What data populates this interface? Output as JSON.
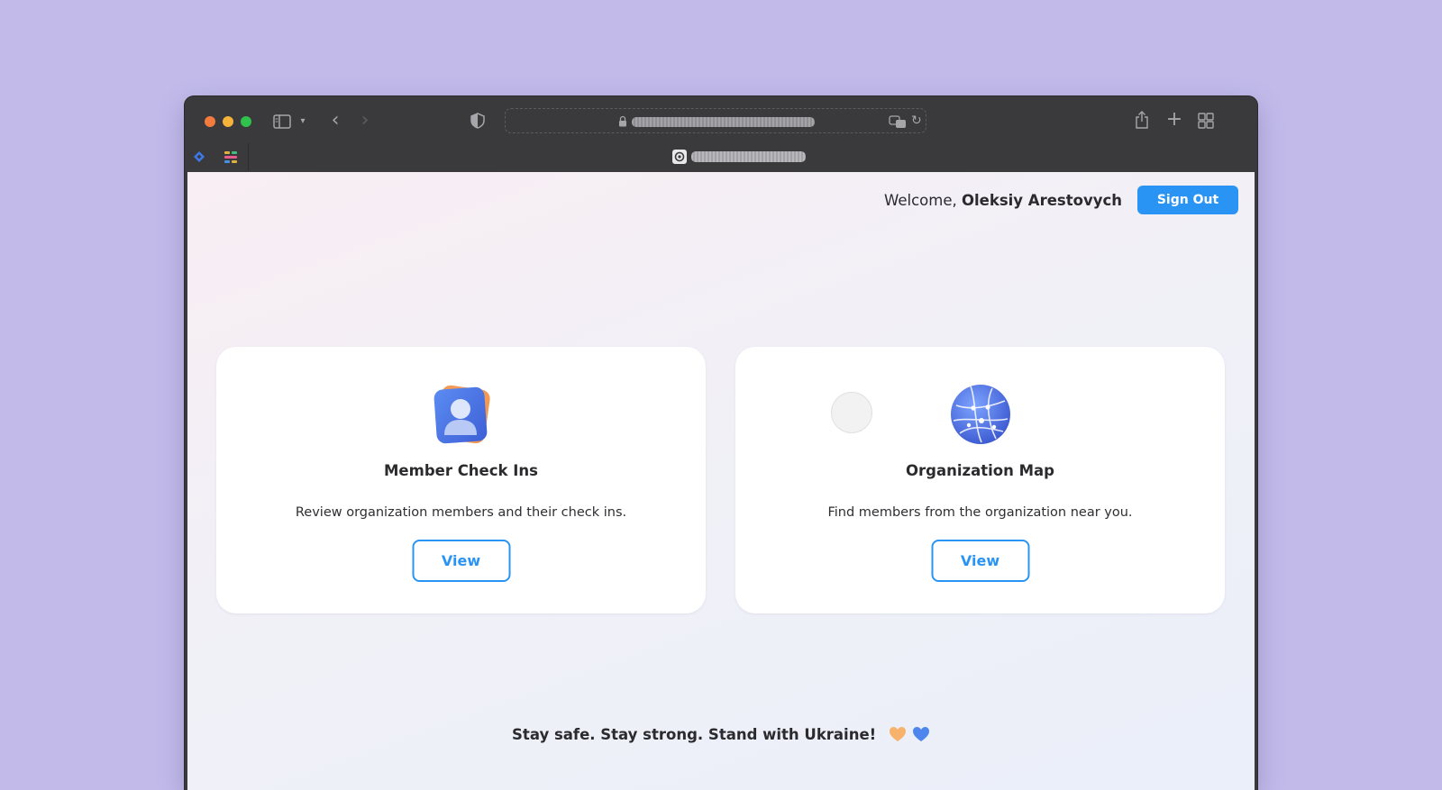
{
  "browser": {
    "toolbar": {
      "back_glyph": "‹",
      "forward_glyph": "›",
      "new_tab_glyph": "+",
      "reload_glyph": "↻",
      "chevron_glyph": "▾"
    },
    "icons": [
      "close-icon",
      "minimize-icon",
      "maximize-icon",
      "sidebar-icon",
      "chevron-down-icon",
      "back-icon",
      "forward-icon",
      "shield-icon",
      "lock-icon",
      "translate-icon",
      "reload-icon",
      "share-icon",
      "new-tab-icon",
      "tab-overview-icon"
    ]
  },
  "header": {
    "welcome_prefix": "Welcome, ",
    "user_name": "Oleksiy Arestovych",
    "sign_out_label": "Sign Out"
  },
  "cards": [
    {
      "title": "Member Check Ins",
      "description": "Review organization members and their check ins.",
      "button_label": "View",
      "icon": "member-icon"
    },
    {
      "title": "Organization Map",
      "description": "Find members from the organization near you.",
      "button_label": "View",
      "icon": "globe-icon"
    }
  ],
  "footer": {
    "text": "Stay safe. Stay strong. Stand with Ukraine!",
    "hearts": [
      "orange-heart-icon",
      "blue-heart-icon"
    ]
  },
  "colors": {
    "background": "#c2bbea",
    "accent": "#2a94f5",
    "chrome": "#3a3a3c"
  }
}
